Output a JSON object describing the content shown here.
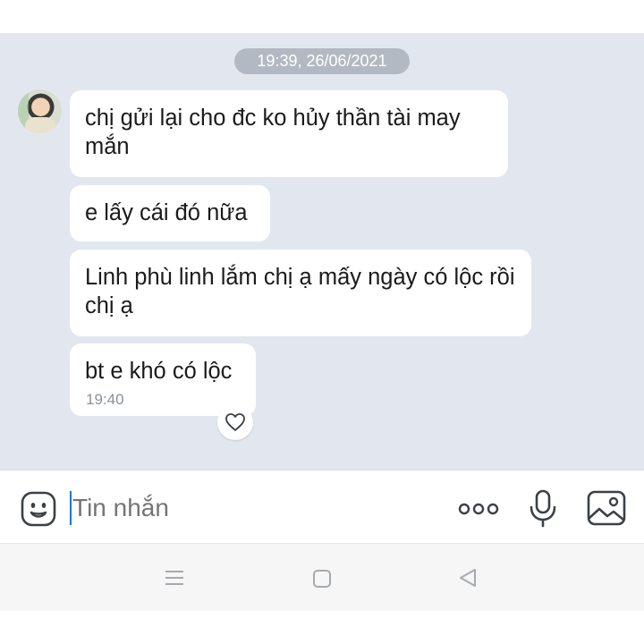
{
  "chat": {
    "timestamp": "19:39, 26/06/2021",
    "messages": [
      {
        "text": "chị gửi lại cho đc ko hủy thần tài may mắn"
      },
      {
        "text": "e lấy cái đó nữa"
      },
      {
        "text": "Linh phù linh lắm chị ạ mấy ngày có lộc rồi chị ạ"
      },
      {
        "text": "bt e khó có lộc",
        "time": "19:40"
      }
    ],
    "reaction_icon": "heart-icon"
  },
  "composer": {
    "placeholder": "Tin nhắn",
    "icons": [
      "sticker-icon",
      "more-options-icon",
      "microphone-icon",
      "gallery-icon"
    ]
  },
  "navbar": {
    "icons": [
      "recent-apps-icon",
      "home-icon",
      "back-icon"
    ]
  },
  "colors": {
    "chat_background": "#e2e7ef",
    "bubble": "#ffffff",
    "timestamp_pill": "#b3b9c2",
    "caret": "#1a73e8"
  }
}
